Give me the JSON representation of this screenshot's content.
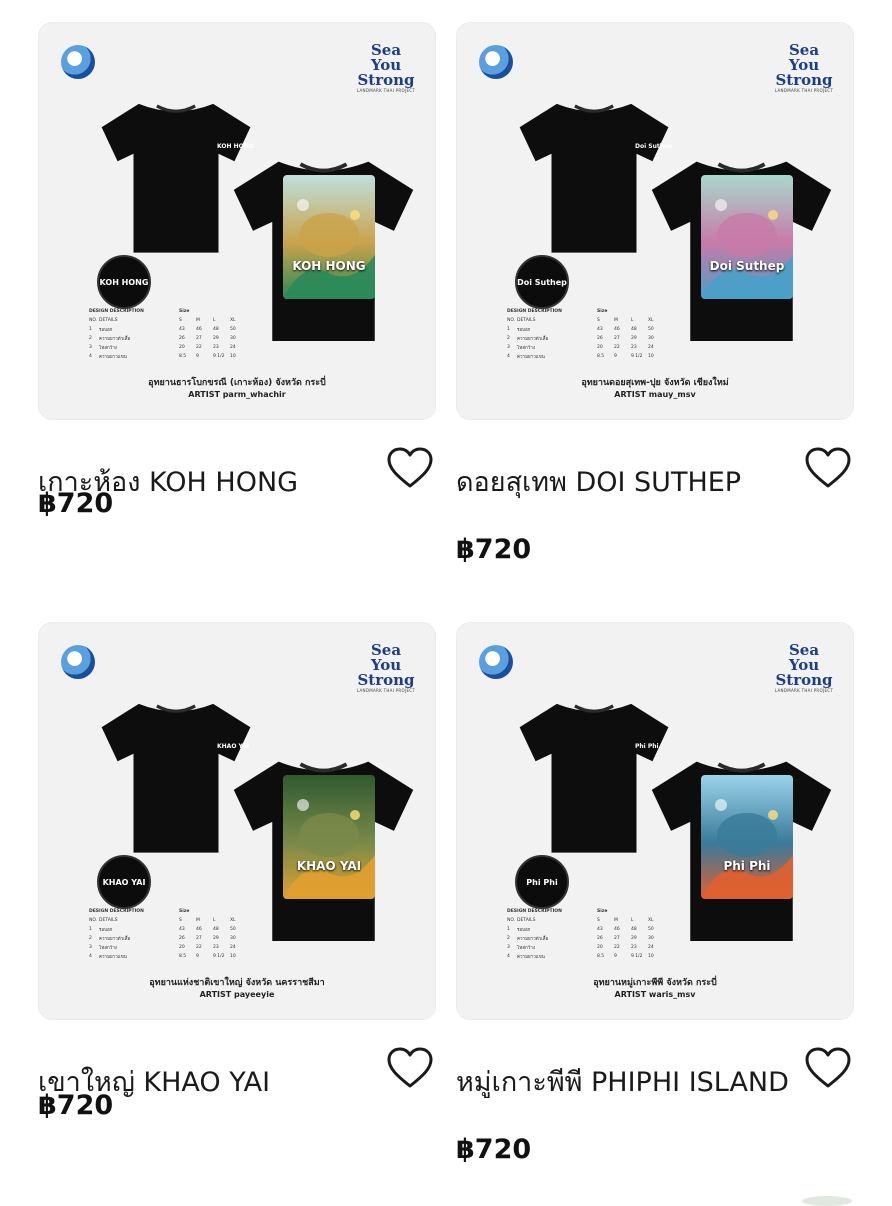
{
  "products": [
    {
      "name": "เกาะห้อง KOH HONG",
      "price": "฿720",
      "art_title": "KOH HONG",
      "badge": "KOH HONG",
      "caption": "อุทยานธารโบกขรณี (เกาะห้อง) จังหวัด กระบี่",
      "artist": "ARTIST  parm_whachir",
      "colors": {
        "sky": "#bfe0de",
        "main": "#caa24a",
        "accent": "#2a8a5a"
      }
    },
    {
      "name": "ดอยสุเทพ DOI SUTHEP",
      "price": "฿720",
      "art_title": "Doi Suthep",
      "badge": "Doi Suthep",
      "caption": "อุทยานดอยสุเทพ-ปุย จังหวัด เชียงใหม่",
      "artist": "ARTIST  mauy_msv",
      "colors": {
        "sky": "#a8d8cc",
        "main": "#c77aa8",
        "accent": "#4aa0c8"
      }
    },
    {
      "name": "เขาใหญ่ KHAO YAI",
      "price": "฿720",
      "art_title": "KHAO YAI",
      "badge": "KHAO YAI",
      "caption": "อุทยานแห่งชาติเขาใหญ่ จังหวัด นครราชสีมา",
      "artist": "ARTIST  payeeyie",
      "colors": {
        "sky": "#2f5a30",
        "main": "#7a8a4a",
        "accent": "#e0a030"
      }
    },
    {
      "name": "หมู่เกาะพีพี PHIPHI ISLAND",
      "price": "฿720",
      "art_title": "Phi Phi",
      "badge": "Phi Phi",
      "caption": "อุทยานหมู่เกาะพีพี จังหวัด กระบี่",
      "artist": "ARTIST  waris_msv",
      "colors": {
        "sky": "#9ad4ea",
        "main": "#3a7a9a",
        "accent": "#e06030"
      }
    }
  ],
  "brand": {
    "logo_line1": "Sea You",
    "logo_line2": "Strong",
    "logo_sub": "LANDMARK THAI PROJECT"
  },
  "size_table": {
    "heading": "DESIGN DESCRIPTION",
    "size_label": "Size",
    "header": [
      "NO.",
      "DETAILS",
      "S",
      "M",
      "L",
      "XL"
    ],
    "rows": [
      [
        "1",
        "รอบอก",
        "43",
        "46",
        "48",
        "50"
      ],
      [
        "2",
        "ความยาวตัวเสื้อ",
        "26",
        "27",
        "29",
        "30"
      ],
      [
        "3",
        "ไหล่กว้าง",
        "20",
        "22",
        "23",
        "24"
      ],
      [
        "4",
        "ความยาวแขน",
        "8.5",
        "9",
        "9 1/2",
        "10"
      ]
    ]
  }
}
